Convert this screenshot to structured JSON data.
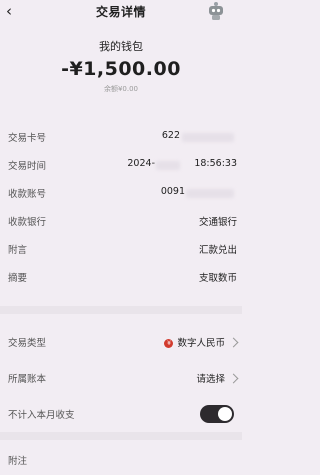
{
  "header": {
    "title": "交易详情",
    "back_icon": "chevron-left-icon",
    "assistant_icon": "robot-icon"
  },
  "hero": {
    "name": "我的钱包",
    "amount": "-¥1,500.00",
    "balance": "余额¥0.00"
  },
  "details": [
    {
      "label": "交易卡号",
      "value": "622"
    },
    {
      "label": "交易时间",
      "value_left": "2024-",
      "value_right": "18:56:33"
    },
    {
      "label": "收款账号",
      "value": "0091"
    },
    {
      "label": "收款银行",
      "value": "交通银行"
    },
    {
      "label": "附言",
      "value": "汇款兑出"
    },
    {
      "label": "摘要",
      "value": "支取数币"
    }
  ],
  "settings": [
    {
      "label": "交易类型",
      "value": "数字人民币",
      "icon": "rmb-icon"
    },
    {
      "label": "所属账本",
      "value": "请选择"
    }
  ],
  "toggle": {
    "label": "不计入本月收支",
    "state": "on"
  },
  "note": {
    "label": "附注"
  },
  "colors": {
    "background": "#f2edf3",
    "toggle_on": "#2d2a2e",
    "rmb_red": "#d23b2e"
  }
}
